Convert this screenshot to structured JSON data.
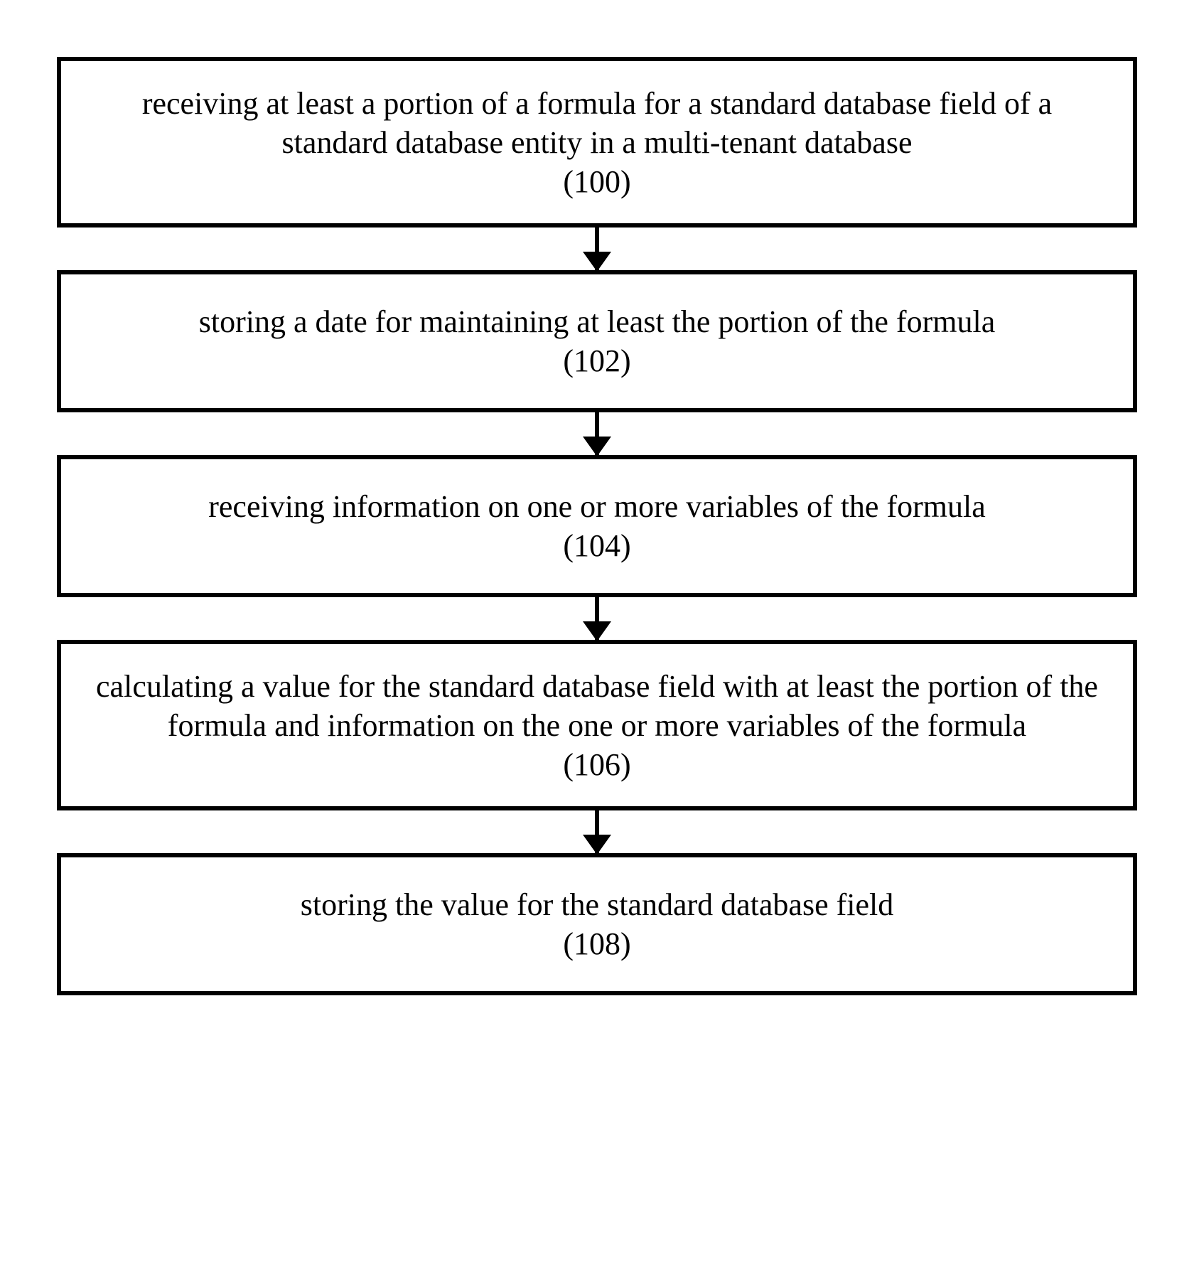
{
  "steps": [
    {
      "text": "receiving at least a portion of a formula for a standard database field of a standard database entity in a multi-tenant database",
      "num": "(100)"
    },
    {
      "text": "storing a date for maintaining at least the portion of the formula",
      "num": "(102)"
    },
    {
      "text": "receiving information on one or more variables of the formula",
      "num": "(104)"
    },
    {
      "text": "calculating a value for the standard database field with at least the portion of the formula and information on the one or more variables of the formula",
      "num": "(106)"
    },
    {
      "text": "storing the value for the standard database field",
      "num": "(108)"
    }
  ]
}
